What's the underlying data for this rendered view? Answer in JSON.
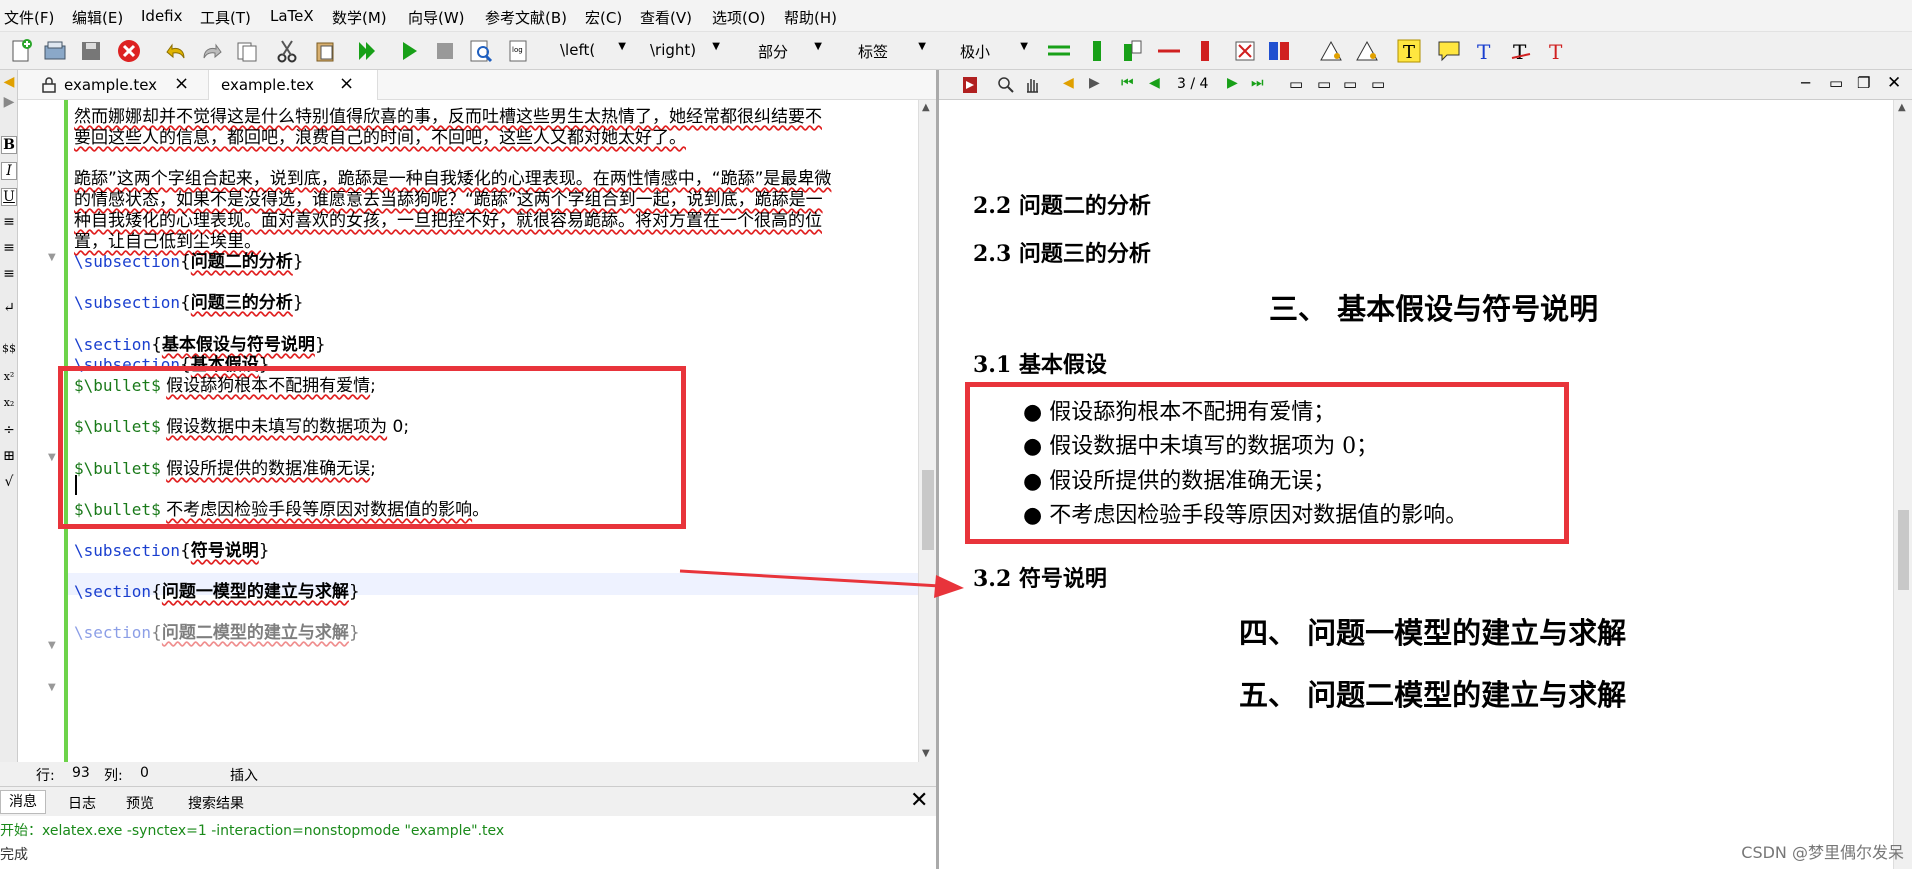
{
  "menu": [
    "文件(F)",
    "编辑(E)",
    "Idefix",
    "工具(T)",
    "LaTeX",
    "数学(M)",
    "向导(W)",
    "参考文献(B)",
    "宏(C)",
    "查看(V)",
    "选项(O)",
    "帮助(H)"
  ],
  "toolbar": {
    "left_dd": "\\left(",
    "right_dd": "\\right)",
    "part_dd": "部分",
    "label_dd": "标签",
    "size_dd": "极小"
  },
  "left_toolbar": [
    "B",
    "I",
    "U",
    "$$",
    "x²",
    "x₂",
    "÷",
    "√"
  ],
  "tabs": [
    {
      "name": "example.tex",
      "close": "×"
    },
    {
      "name": "example.tex",
      "close": "×"
    }
  ],
  "editor": {
    "p1": [
      "然而娜娜却并不觉得这是什么特别值得欣喜的事，反而吐槽这些男生太热情了，她经常都很纠结要不",
      "要回这些人的信息，都回吧，浪费自己的时间，不回吧，这些人又都对她太好了。"
    ],
    "p2": [
      "跪舔”这两个字组合起来，说到底，跪舔是一种自我矮化的心理表现。在两性情感中，“跪舔”是最卑微",
      "的情感状态，如果不是没得选，谁愿意去当舔狗呢？“跪舔”这两个字组合到一起，说到底，跪舔是一",
      "种自我矮化的心理表现。面对喜欢的女孩，一旦把控不好，就很容易跪舔。将对方置在一个很高的位",
      "置，让自己低到尘埃里。"
    ],
    "subsection_cmd": "\\subsection",
    "section_cmd": "\\section",
    "bullet_cmd": "$\\bullet$",
    "sub_q2": "问题二的分析",
    "sub_q3": "问题三的分析",
    "sec_assume": "基本假设与符号说明",
    "sub_assume": "基本假设",
    "b1": "假设舔狗根本不配拥有爱情",
    "b1_end": ";",
    "b2": "假设数据中未填写的数据项为",
    "b2_end": "0;",
    "b3": "假设所提供的数据准确无误",
    "b3_end": ";",
    "b4": "不考虑因检验手段等原因对数据值的影响",
    "b4_end": "。",
    "sub_symbols": "符号说明",
    "sec_m1": "问题一模型的建立与求解",
    "sec_m2_partial": "问题二模型的建立与求解"
  },
  "status": {
    "row_label": "行:",
    "row": "93",
    "col_label": "列:",
    "col": "0",
    "mode": "插入"
  },
  "msg_tabs": [
    "消息",
    "日志",
    "预览",
    "搜索结果"
  ],
  "msg_line": "开始：xelatex.exe -synctex=1 -interaction=nonstopmode \"example\".tex",
  "msg_line2": "完成",
  "preview_nav": {
    "page": "3 / 4"
  },
  "preview": {
    "s22": "2.2  问题二的分析",
    "s23": "2.3  问题三的分析",
    "sec3": "三、  基本假设与符号说明",
    "s31": "3.1  基本假设",
    "bullets": [
      "● 假设舔狗根本不配拥有爱情；",
      "● 假设数据中未填写的数据项为 0；",
      "● 假设所提供的数据准确无误；",
      "● 不考虑因检验手段等原因对数据值的影响。"
    ],
    "s32": "3.2  符号说明",
    "sec4": "四、  问题一模型的建立与求解",
    "sec5": "五、  问题二模型的建立与求解"
  },
  "watermark": "CSDN @梦里偶尔发呆",
  "colors": {
    "annotation_red": "#e8343b",
    "latex_cmd": "#1a3fcf",
    "math": "#1a7a1a",
    "modified_bar": "#6dd34a"
  }
}
